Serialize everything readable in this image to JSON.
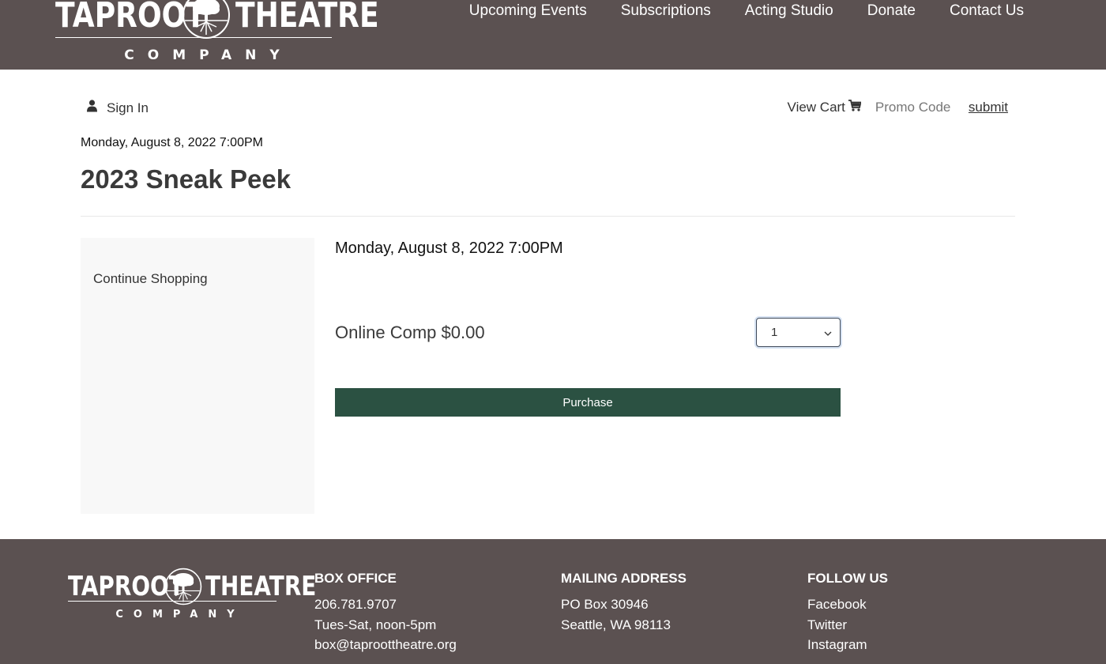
{
  "header": {
    "logo": {
      "word1": "TAPROOT",
      "word2": "THEATRE",
      "company": "COMPANY"
    },
    "nav": [
      {
        "label": "Upcoming Events"
      },
      {
        "label": "Subscriptions"
      },
      {
        "label": "Acting Studio"
      },
      {
        "label": "Donate"
      },
      {
        "label": "Contact Us"
      }
    ]
  },
  "utility": {
    "sign_in": "Sign In",
    "view_cart": "View Cart",
    "promo_placeholder": "Promo Code",
    "submit": "submit"
  },
  "event": {
    "date": "Monday, August 8, 2022 7:00PM",
    "title": "2023 Sneak Peek"
  },
  "sidebar": {
    "continue_shopping": "Continue Shopping"
  },
  "main": {
    "performance_date": "Monday, August 8, 2022 7:00PM",
    "ticket_label": "Online Comp $0.00",
    "quantity": "1",
    "purchase": "Purchase"
  },
  "footer": {
    "box_office": {
      "heading": "BOX OFFICE",
      "phone": "206.781.9707",
      "hours": "Tues-Sat, noon-5pm",
      "email": "box@taproottheatre.org"
    },
    "mailing": {
      "heading": "MAILING ADDRESS",
      "line1": "PO Box 30946",
      "line2": "Seattle, WA 98113"
    },
    "follow": {
      "heading": "FOLLOW US",
      "links": [
        "Facebook",
        "Twitter",
        "Instagram"
      ]
    }
  },
  "colors": {
    "header_bg": "#5b5151",
    "button_bg": "#2b5142",
    "sidebar_bg": "#f8f8f8"
  }
}
